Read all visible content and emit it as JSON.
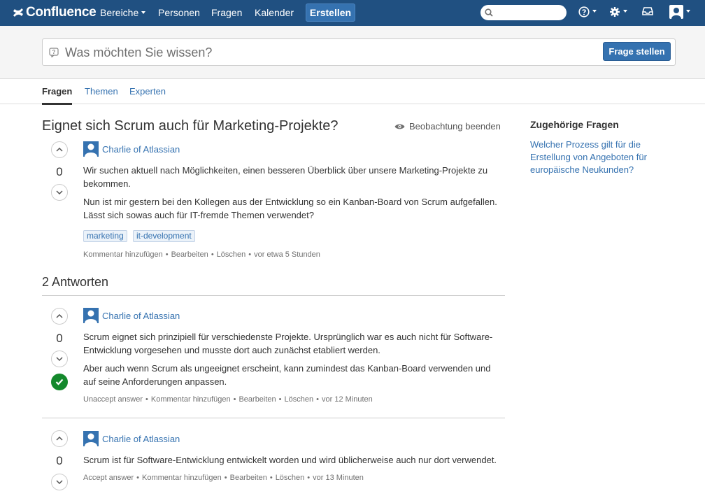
{
  "nav": {
    "logo": "Confluence",
    "items": [
      "Bereiche",
      "Personen",
      "Fragen",
      "Kalender"
    ],
    "create_label": "Erstellen",
    "search_placeholder": "",
    "icons": [
      "search-icon",
      "help-icon",
      "gear-icon",
      "inbox-icon",
      "user-icon"
    ]
  },
  "ask": {
    "placeholder": "Was möchten Sie wissen?",
    "button": "Frage stellen"
  },
  "tabs": [
    "Fragen",
    "Themen",
    "Experten"
  ],
  "question": {
    "title": "Eignet sich Scrum auch für Marketing-Projekte?",
    "watch_label": "Beobachtung beenden",
    "votes": "0",
    "author": "Charlie of Atlassian",
    "paragraphs": [
      "Wir suchen aktuell nach Möglichkeiten, einen besseren Überblick über unsere Marketing-Projekte zu bekommen.",
      "Nun ist mir gestern bei den Kollegen aus der Entwicklung so ein Kanban-Board von Scrum aufgefallen. Lässt sich sowas auch für IT-fremde Themen verwendet?"
    ],
    "tags": [
      "marketing",
      "it-development"
    ],
    "actions": [
      "Kommentar hinzufügen",
      "Bearbeiten",
      "Löschen"
    ],
    "time": "vor etwa 5 Stunden"
  },
  "answers_title": "2 Antworten",
  "answers": [
    {
      "votes": "0",
      "accepted": true,
      "author": "Charlie of Atlassian",
      "paragraphs": [
        "Scrum eignet sich prinzipiell für verschiedenste Projekte. Ursprünglich war es auch nicht für Software-Entwicklung vorgesehen und musste dort auch zunächst etabliert werden.",
        "Aber auch wenn Scrum als ungeeignet erscheint, kann zumindest das Kanban-Board verwenden und auf seine Anforderungen anpassen."
      ],
      "actions": [
        "Unaccept answer",
        "Kommentar hinzufügen",
        "Bearbeiten",
        "Löschen"
      ],
      "time": "vor 12 Minuten"
    },
    {
      "votes": "0",
      "accepted": false,
      "author": "Charlie of Atlassian",
      "paragraphs": [
        "Scrum ist für Software-Entwicklung entwickelt worden und wird üblicherweise auch nur dort verwendet."
      ],
      "actions": [
        "Accept answer",
        "Kommentar hinzufügen",
        "Bearbeiten",
        "Löschen"
      ],
      "time": "vor 13 Minuten"
    }
  ],
  "sidebar": {
    "title": "Zugehörige Fragen",
    "links": [
      "Welcher Prozess gilt für die Erstellung von Angeboten für europäische Neukunden?"
    ]
  },
  "colors": {
    "header": "#205081",
    "link": "#3572b0",
    "accepted": "#14892c"
  }
}
